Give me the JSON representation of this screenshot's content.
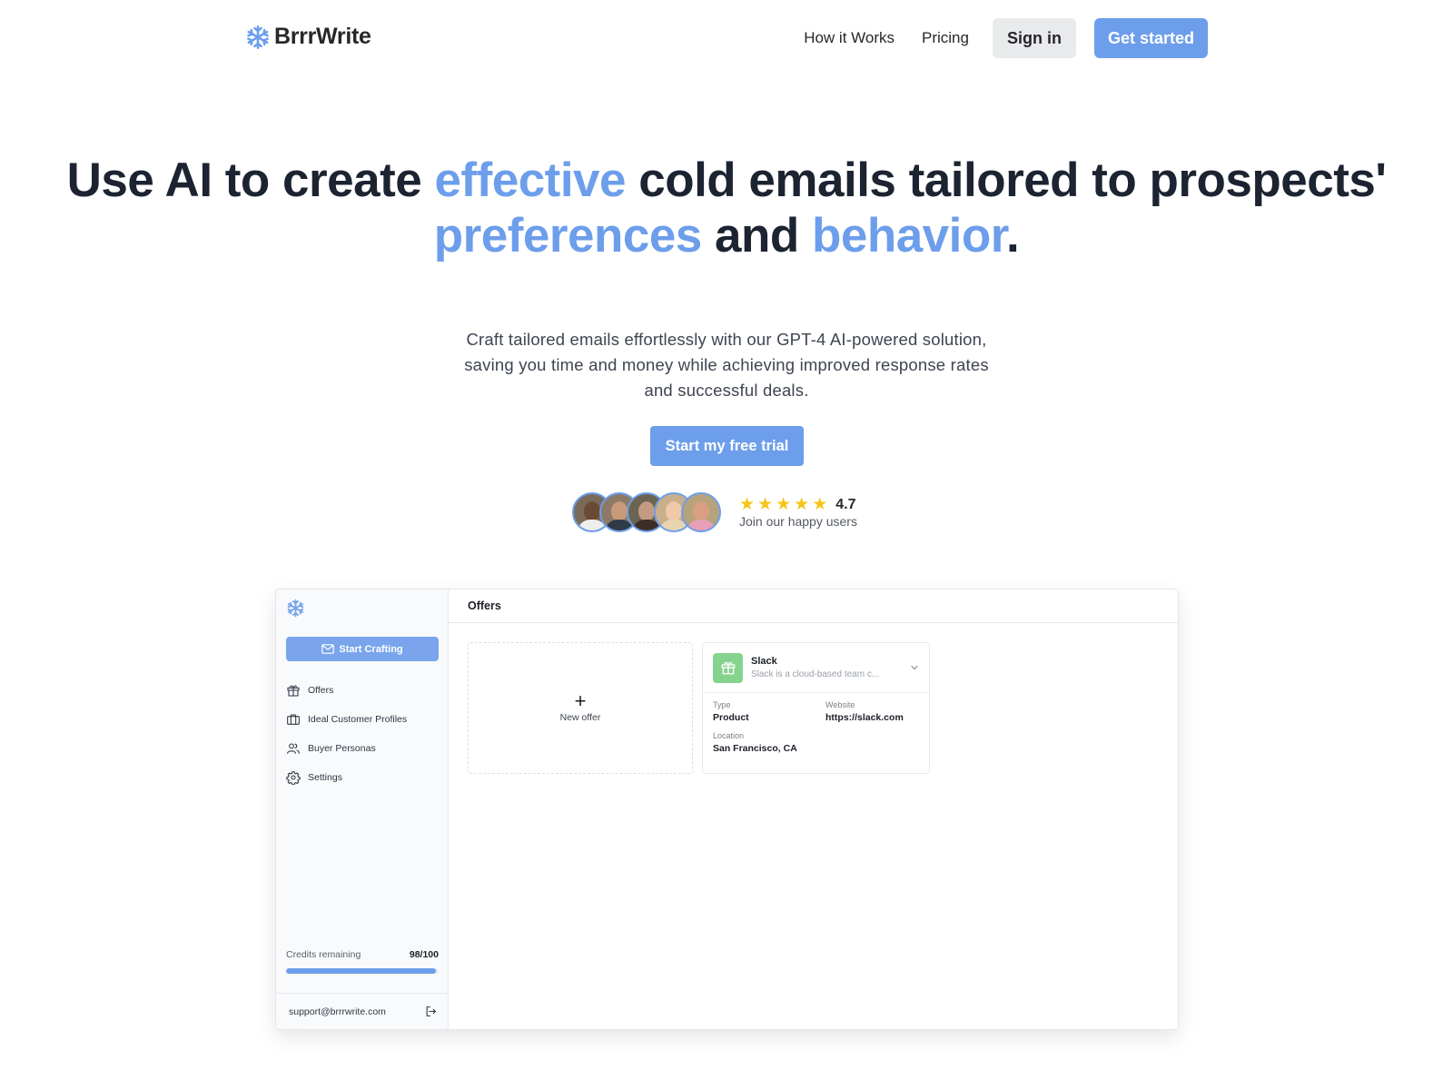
{
  "brand": {
    "name": "BrrrWrite",
    "logo_icon": "snowflake-icon",
    "accent_color": "#6d9eeb"
  },
  "nav": {
    "links": [
      {
        "label": "How it Works"
      },
      {
        "label": "Pricing"
      }
    ],
    "signin_label": "Sign in",
    "get_started_label": "Get started"
  },
  "hero": {
    "title_parts": [
      {
        "text": "Use AI to create ",
        "highlight": false
      },
      {
        "text": "effective",
        "highlight": true
      },
      {
        "text": " cold emails tailored to prospects' ",
        "highlight": false
      },
      {
        "text": "preferences",
        "highlight": true
      },
      {
        "text": " and ",
        "highlight": false
      },
      {
        "text": "behavior",
        "highlight": true
      },
      {
        "text": ".",
        "highlight": false
      }
    ],
    "subtitle_lines": [
      "Craft tailored emails effortlessly with our GPT-4 AI-powered solution,",
      "saving you time and money while achieving improved response rates",
      "and successful deals."
    ],
    "cta_label": "Start my free trial"
  },
  "social_proof": {
    "avatar_count": 5,
    "stars": 5,
    "rating": "4.7",
    "caption": "Join our happy users"
  },
  "app_preview": {
    "sidebar": {
      "start_button_label": "Start Crafting",
      "items": [
        {
          "label": "Offers",
          "icon": "gift-icon"
        },
        {
          "label": "Ideal Customer Profiles",
          "icon": "briefcase-icon"
        },
        {
          "label": "Buyer Personas",
          "icon": "users-icon"
        },
        {
          "label": "Settings",
          "icon": "gear-icon"
        }
      ],
      "credits_label": "Credits remaining",
      "credits_value": "98/100",
      "credits_fraction": 0.98,
      "support_email": "support@brrrwrite.com"
    },
    "main": {
      "title": "Offers",
      "new_offer_label": "New offer",
      "offer": {
        "name": "Slack",
        "description": "Slack is a cloud-based team c...",
        "fields": [
          {
            "label": "Type",
            "value": "Product"
          },
          {
            "label": "Website",
            "value": "https://slack.com"
          },
          {
            "label": "Location",
            "value": "San Francisco, CA"
          }
        ]
      }
    }
  }
}
